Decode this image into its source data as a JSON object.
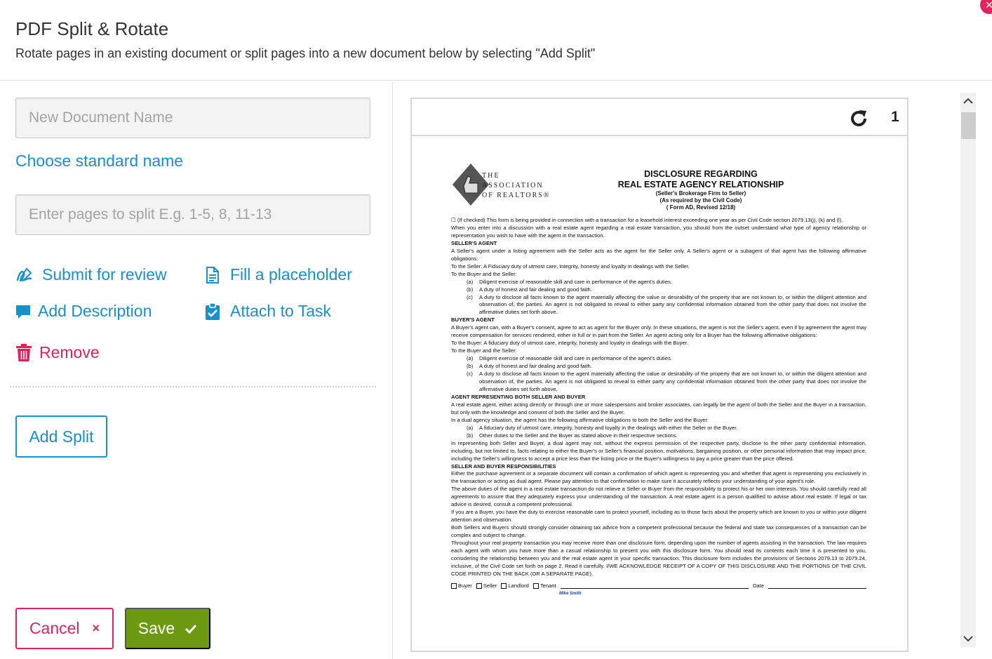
{
  "dialog": {
    "title": "PDF Split & Rotate",
    "subtitle": "Rotate pages in an existing document or split pages into a new document below by selecting \"Add Split\"",
    "close_icon": "close-icon"
  },
  "form": {
    "document_name": {
      "value": "",
      "placeholder": "New Document Name"
    },
    "choose_standard_name": "Choose standard name",
    "pages_to_split": {
      "value": "",
      "placeholder": "Enter pages to split E.g. 1-5, 8, 11-13"
    }
  },
  "actions": {
    "submit_for_review": "Submit for review",
    "fill_placeholder": "Fill a placeholder",
    "add_description": "Add Description",
    "attach_to_task": "Attach to Task",
    "remove": "Remove"
  },
  "buttons": {
    "add_split": "Add Split",
    "cancel": "Cancel",
    "save": "Save"
  },
  "colors": {
    "link_blue": "#1a8fc9",
    "danger_pink": "#d8265c",
    "save_green": "#6b9a12"
  },
  "viewer": {
    "page_number": "1",
    "rotate_icon": "rotate-clockwise-icon",
    "document": {
      "logo_text": [
        "THE",
        "ASSOCIATION",
        "OF REALTORS®"
      ],
      "heading_1": "DISCLOSURE REGARDING",
      "heading_2": "REAL ESTATE AGENCY RELATIONSHIP",
      "heading_3": "(Seller's Brokerage Firm to Seller)",
      "heading_4": "(As required by the Civil Code)",
      "heading_5": "(             Form AD, Revised 12/18)",
      "intro_1": "☐ (If checked) This form is being provided in connection with a transaction for a leasehold interest exceeding one year as per Civil Code section 2079.13(j), (k) and (l).",
      "intro_2": "When you enter into a discussion with a real estate agent regarding a real estate transaction, you should from the outset understand what type of agency relationship or representation you wish to have with the agent in the transaction.",
      "sellers_agent_hd": "SELLER'S AGENT",
      "sellers_agent_p1": "A Seller's agent under a listing agreement with the Seller acts as the agent for the Seller only. A Seller's agent or a subagent of that agent has the following affirmative obligations:",
      "sellers_agent_p2": "To the Seller: A Fiduciary duty of utmost care, integrity, honesty and loyalty in dealings with the Seller.",
      "sellers_agent_p3": "To the Buyer and the Seller:",
      "sa_a": "Diligent exercise of reasonable skill and care in performance of the agent's duties.",
      "sa_b": "A duty of honest and fair dealing and good faith.",
      "sa_c": "A duty to disclose all facts known to the agent materially affecting the value or desirability of the property that are not known to, or within the diligent attention and observation of, the parties. An agent is not obligated to reveal to either party any confidential information obtained from the other party that does not involve the affirmative duties set forth above.",
      "buyers_agent_hd": "BUYER'S AGENT",
      "buyers_agent_p1": "A Buyer's agent can, with a Buyer's consent, agree to act as agent for the Buyer only. In these situations, the agent is not the Seller's agent, even if by agreement the agent may receive compensation for services rendered, either in full or in part from the Seller. An agent acting only for a Buyer has the following affirmative obligations:",
      "buyers_agent_p2": "To the Buyer: A fiduciary duty of utmost care, integrity, honesty and loyalty in dealings with the Buyer.",
      "buyers_agent_p3": "To the Buyer and the Seller:",
      "ba_a": "Diligent exercise of reasonable skill and care in performance of the agent's duties.",
      "ba_b": "A duty of honest and fair dealing and good faith.",
      "ba_c": "A duty to disclose all facts known to the agent materially affecting the value or desirability of the property that are not known to, or within the diligent attention and observation of, the parties. An agent is not obligated to reveal to either party any confidential information obtained from the other party that does not involve the affirmative duties set forth above.",
      "both_hd": "AGENT REPRESENTING BOTH SELLER AND BUYER",
      "both_p1": "A real estate agent, either acting directly or through one or more salespersons and broker associates, can legally be the agent of both the Seller and the Buyer in a transaction, but only with the knowledge and consent of both the Seller and the Buyer.",
      "both_p2": "In a dual agency situation, the agent has the following affirmative obligations to both the Seller and the Buyer:",
      "both_a": "A fiduciary duty of utmost care, integrity, honesty and loyalty in the dealings with either the Seller or the Buyer.",
      "both_b": "Other duties to the Seller and the Buyer as stated above in their respective sections.",
      "both_p3": "In representing both Seller and Buyer, a dual agent may not, without the express permission of the respective party, disclose to the other party confidential information, including, but not limited to, facts relating to either the Buyer's or Seller's financial position, motivations, bargaining position, or other personal information that may impact price, including the Seller's willingness to accept a price less than the listing price or the Buyer's willingness to pay a price greater than the price offered.",
      "resp_hd": "SELLER AND BUYER RESPONSIBILITIES",
      "resp_p1": "Either the purchase agreement or a separate document will contain a confirmation of which agent is representing you and whether that agent is representing you exclusively in the transaction or acting as dual agent. Please pay attention to that confirmation to make sure it accurately reflects your understanding of your agent's role.",
      "resp_p2": "The above duties of the agent in a real estate transaction do not relieve a Seller or Buyer from the responsibility to protect his or her own interests. You should carefully read all agreements to assure that they adequately express your understanding of the transaction. A real estate agent is a person qualified to advise about real estate. If legal or tax advice is desired, consult a competent professional.",
      "resp_p3": "If you are a Buyer, you have the duty to exercise reasonable care to protect yourself, including as to those facts about the property which are known to you or within your diligent attention and observation.",
      "resp_p4": "Both Sellers and Buyers should strongly consider obtaining tax advice from a competent professional because the federal and state tax consequences of a transaction can be complex and subject to change.",
      "resp_p5": "Throughout your real property transaction you may receive more than one disclosure form, depending upon the number of agents assisting in the transaction. The law requires each agent with whom you have more than a casual relationship to present you with this disclosure form. You should read its contents each time it is presented to you, considering the relationship between you and the real estate agent in your specific transaction. This disclosure form includes the provisions of Sections 2079.13 to 2079.24, inclusive, of the Civil Code set forth on page 2. Read it carefully. I/WE ACKNOWLEDGE RECEIPT OF A COPY OF THIS DISCLOSURE AND THE PORTIONS OF THE CIVIL CODE PRINTED ON THE BACK (OR A SEPARATE PAGE).",
      "sig_buyer": "Buyer",
      "sig_seller": "Seller",
      "sig_landlord": "Landlord",
      "sig_tenant": "Tenant",
      "sig_date": "Date",
      "sig_name": "Mike Smith",
      "m_a": "(a)",
      "m_b": "(b)",
      "m_c": "(c)"
    }
  },
  "scrollbar": {
    "up_icon": "chevron-up-icon",
    "down_icon": "chevron-down-icon"
  }
}
